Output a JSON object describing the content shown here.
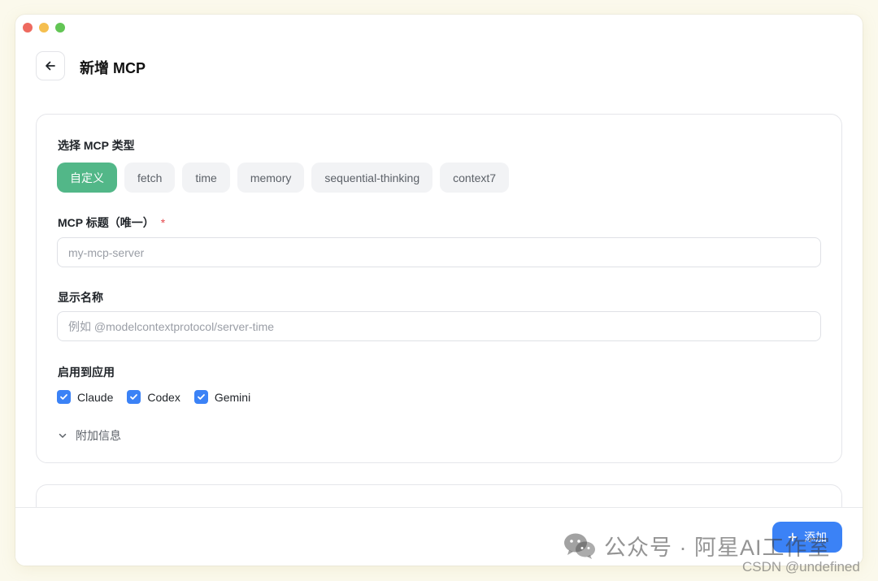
{
  "header": {
    "title": "新增 MCP"
  },
  "type_section": {
    "label": "选择 MCP 类型",
    "chips": [
      "自定义",
      "fetch",
      "time",
      "memory",
      "sequential-thinking",
      "context7"
    ],
    "active_index": 0
  },
  "title_field": {
    "label": "MCP 标题（唯一）",
    "required_mark": "*",
    "placeholder": "my-mcp-server"
  },
  "name_field": {
    "label": "显示名称",
    "placeholder": "例如 @modelcontextprotocol/server-time"
  },
  "apps": {
    "label": "启用到应用",
    "items": [
      "Claude",
      "Codex",
      "Gemini"
    ]
  },
  "extra": {
    "label": "附加信息"
  },
  "footer": {
    "add_label": "添加"
  },
  "watermark": {
    "wechat": "公众号 · 阿星AI工作室",
    "csdn": "CSDN @undefined"
  },
  "colors": {
    "accent_green": "#52b788",
    "accent_blue": "#3b82f6",
    "required": "#e5484d"
  }
}
